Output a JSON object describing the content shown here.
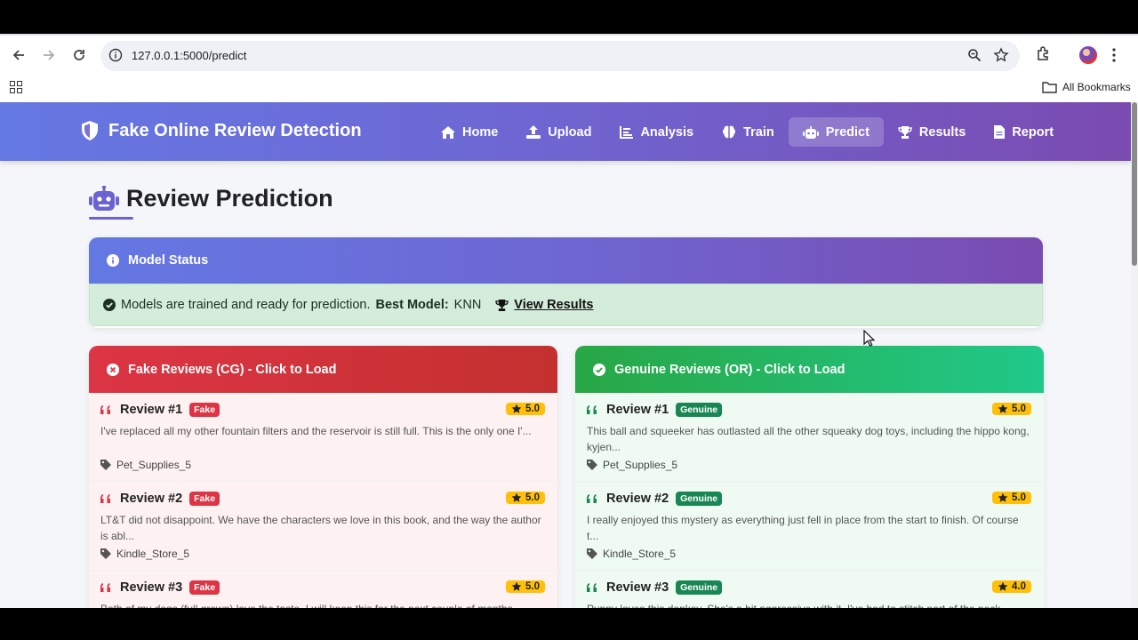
{
  "browser": {
    "url": "127.0.0.1:5000/predict",
    "bookmarks_label": "All Bookmarks"
  },
  "navbar": {
    "brand": "Fake Online Review Detection",
    "items": [
      {
        "label": "Home",
        "icon": "home-icon"
      },
      {
        "label": "Upload",
        "icon": "upload-icon"
      },
      {
        "label": "Analysis",
        "icon": "chart-icon"
      },
      {
        "label": "Train",
        "icon": "brain-icon"
      },
      {
        "label": "Predict",
        "icon": "robot-icon",
        "active": true
      },
      {
        "label": "Results",
        "icon": "trophy-icon"
      },
      {
        "label": "Report",
        "icon": "file-icon"
      }
    ]
  },
  "page": {
    "title": "Review Prediction"
  },
  "model_status": {
    "header": "Model Status",
    "message": "Models are trained and ready for prediction.",
    "best_model_label": "Best Model:",
    "best_model_value": "KNN",
    "view_results": "View Results"
  },
  "fake_reviews": {
    "header": "Fake Reviews (CG) - Click to Load",
    "badge": "Fake",
    "items": [
      {
        "title": "Review #1",
        "rating": "5.0",
        "text": "I've replaced all my other fountain filters and the reservoir is still full. This is the only one I'...",
        "category": "Pet_Supplies_5"
      },
      {
        "title": "Review #2",
        "rating": "5.0",
        "text": "LT&T did not disappoint. We have the characters we love in this book, and the way the author is abl...",
        "category": "Kindle_Store_5"
      },
      {
        "title": "Review #3",
        "rating": "5.0",
        "text": "Both of my dogs (full grown) love the taste. I will keep this for the next couple of months...",
        "category": ""
      }
    ]
  },
  "genuine_reviews": {
    "header": "Genuine Reviews (OR) - Click to Load",
    "badge": "Genuine",
    "items": [
      {
        "title": "Review #1",
        "rating": "5.0",
        "text": "This ball and squeeker has outlasted all the other squeaky dog toys, including the hippo kong, kyjen...",
        "category": "Pet_Supplies_5"
      },
      {
        "title": "Review #2",
        "rating": "5.0",
        "text": "I really enjoyed this mystery as everything just fell in place from the start to finish. Of course t...",
        "category": "Kindle_Store_5"
      },
      {
        "title": "Review #3",
        "rating": "4.0",
        "text": "Puppy loves this donkey. She's a bit aggressive with it. I've had to stitch part of the neck...",
        "category": ""
      }
    ]
  }
}
